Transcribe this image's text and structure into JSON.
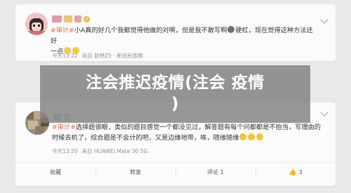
{
  "post1": {
    "tag": "#审计#",
    "text": "小A真的好几个我都觉得他做的对啊，但是我不敢写啊",
    "text_after_emoji": "硬杠，现在觉得这种方法还好",
    "text_line2": "一点",
    "time": "今天13:22",
    "source": "来自 联想Z5 · 新浪民族眼"
  },
  "post2": {
    "tag": "#审计#",
    "text": "选择题很眼，类似的题目感觉一个都没见过，解答题有每个问都都是不抬当，写理由的",
    "text_line2": "时候去机了，综合题是不会计的吧，又是边缘地带，唉，随缘随缘",
    "time": "今天13:20",
    "source": "来自 HUAWEI Mate 30 5G"
  },
  "actions": {
    "favorite": "收藏",
    "repost": "转发",
    "comment": "评论 1",
    "like": "3"
  },
  "overlay": {
    "title_line1": "注会推迟疫情(注会 疫情",
    "title_line2": ")"
  },
  "colors": {
    "tag": "#eb7350",
    "overlay_bg": "#808080",
    "meta_text": "#939393"
  }
}
